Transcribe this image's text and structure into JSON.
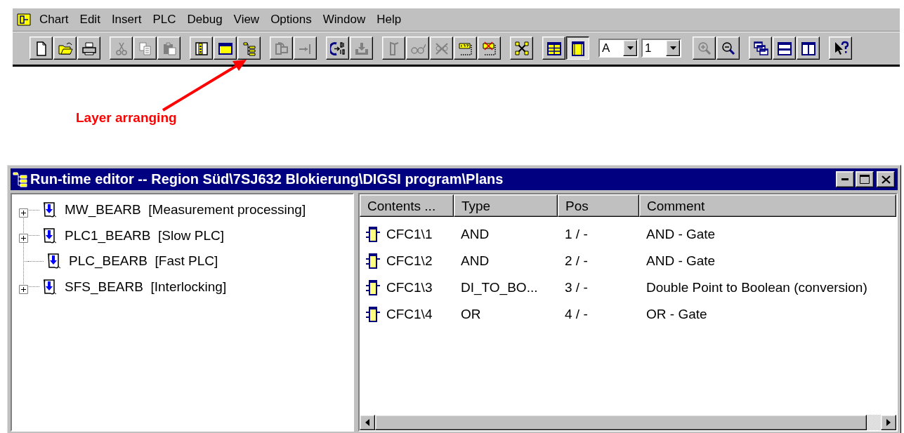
{
  "menu_bar": {
    "items": [
      {
        "label": "Chart"
      },
      {
        "label": "Edit"
      },
      {
        "label": "Insert"
      },
      {
        "label": "PLC"
      },
      {
        "label": "Debug"
      },
      {
        "label": "View"
      },
      {
        "label": "Options"
      },
      {
        "label": "Window"
      },
      {
        "label": "Help"
      }
    ]
  },
  "toolbar": {
    "groups": [
      [
        {
          "kind": "new",
          "disabled": false,
          "pressed": false
        },
        {
          "kind": "open",
          "disabled": false,
          "pressed": false
        },
        {
          "kind": "print",
          "disabled": false,
          "pressed": false
        }
      ],
      [
        {
          "kind": "cut",
          "disabled": true,
          "pressed": false
        },
        {
          "kind": "copy",
          "disabled": true,
          "pressed": false
        },
        {
          "kind": "paste",
          "disabled": true,
          "pressed": false
        }
      ],
      [
        {
          "kind": "object-list",
          "disabled": false,
          "pressed": false
        },
        {
          "kind": "window",
          "disabled": false,
          "pressed": false
        },
        {
          "kind": "layer-tree",
          "disabled": false,
          "pressed": false
        }
      ],
      [
        {
          "kind": "block",
          "disabled": true,
          "pressed": false
        },
        {
          "kind": "connect",
          "disabled": true,
          "pressed": false
        }
      ],
      [
        {
          "kind": "compile",
          "disabled": false,
          "pressed": false
        },
        {
          "kind": "download",
          "disabled": true,
          "pressed": false
        }
      ],
      [
        {
          "kind": "tag",
          "disabled": true,
          "pressed": false
        },
        {
          "kind": "glasses",
          "disabled": true,
          "pressed": false
        },
        {
          "kind": "unlink",
          "disabled": true,
          "pressed": false
        },
        {
          "kind": "number",
          "disabled": false,
          "pressed": false
        },
        {
          "kind": "number-x",
          "disabled": false,
          "pressed": false
        }
      ],
      [
        {
          "kind": "expand",
          "disabled": false,
          "pressed": false
        }
      ],
      [
        {
          "kind": "table",
          "disabled": false,
          "pressed": false
        },
        {
          "kind": "sheet",
          "disabled": false,
          "pressed": true
        }
      ],
      [
        {
          "kind": "combo",
          "value": "A"
        },
        {
          "kind": "combo",
          "value": "1"
        }
      ],
      [
        {
          "kind": "zoom-in",
          "disabled": true,
          "pressed": false
        },
        {
          "kind": "zoom-out",
          "disabled": false,
          "pressed": false
        }
      ],
      [
        {
          "kind": "cascade",
          "disabled": false,
          "pressed": false
        },
        {
          "kind": "tile-horizontal",
          "disabled": false,
          "pressed": false
        },
        {
          "kind": "tile-vertical",
          "disabled": false,
          "pressed": false
        }
      ],
      [
        {
          "kind": "help",
          "disabled": false,
          "pressed": false
        }
      ]
    ]
  },
  "annotation": {
    "label": "Layer arranging"
  },
  "window": {
    "title": "Run-time editor -- Region Süd\\7SJ632 Blokierung\\DIGSI program\\Plans",
    "tree": {
      "items": [
        {
          "label": "MW_BEARB  [Measurement processing]",
          "expandable": true
        },
        {
          "label": "PLC1_BEARB  [Slow PLC]",
          "expandable": true
        },
        {
          "label": "PLC_BEARB  [Fast PLC]",
          "expandable": false
        },
        {
          "label": "SFS_BEARB  [Interlocking]",
          "expandable": true
        }
      ]
    },
    "table": {
      "columns": [
        "Contents ...",
        "Type",
        "Pos",
        "Comment"
      ],
      "rows": [
        [
          "CFC1\\1",
          "AND",
          "1 / -",
          "AND - Gate"
        ],
        [
          "CFC1\\2",
          "AND",
          "2 / -",
          "AND - Gate"
        ],
        [
          "CFC1\\3",
          "DI_TO_BO...",
          "3 / -",
          "Double Point to Boolean (conversion)"
        ],
        [
          "CFC1\\4",
          "OR",
          "4 / -",
          "OR - Gate"
        ]
      ]
    }
  }
}
